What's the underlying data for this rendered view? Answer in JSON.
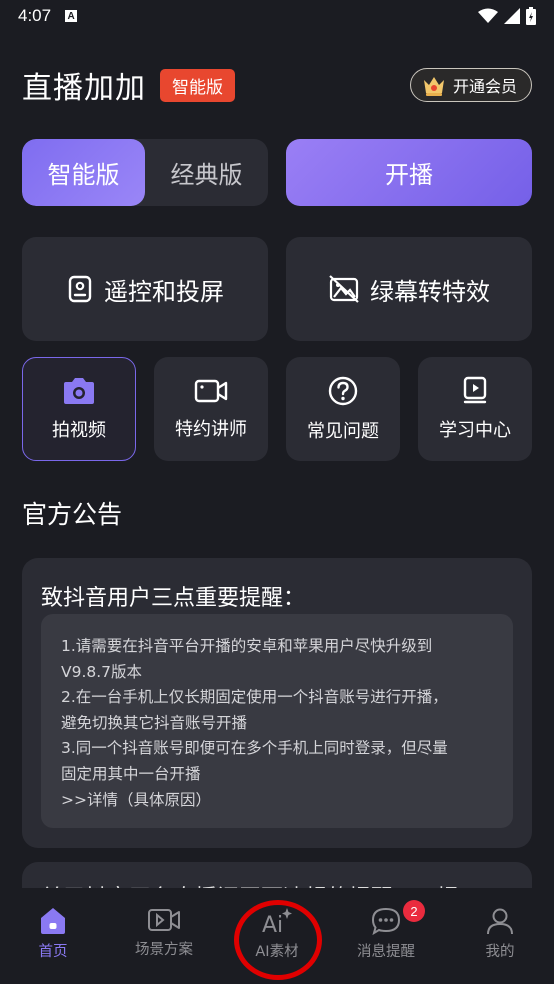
{
  "status_bar": {
    "time": "4:07",
    "notification_letter": "A"
  },
  "header": {
    "title": "直播加加",
    "badge": "智能版",
    "vip_button": "开通会员"
  },
  "mode_toggle": {
    "smart": "智能版",
    "classic": "经典版"
  },
  "broadcast_button": "开播",
  "big_cards": [
    {
      "label": "遥控和投屏",
      "icon": "remote-screen-icon"
    },
    {
      "label": "绿幕转特效",
      "icon": "green-screen-icon"
    }
  ],
  "small_cards": [
    {
      "label": "拍视频",
      "icon": "camera-icon"
    },
    {
      "label": "特约讲师",
      "icon": "video-camera-icon"
    },
    {
      "label": "常见问题",
      "icon": "question-icon"
    },
    {
      "label": "学习中心",
      "icon": "play-book-icon"
    }
  ],
  "announcement": {
    "section_title": "官方公告",
    "card_title": "致抖音用户三点重要提醒：",
    "lines": [
      "1.请需要在抖音平台开播的安卓和苹果用户尽快升级到",
      "V9.8.7版本",
      "2.在一台手机上仅长期固定使用一个抖音账号进行开播，",
      "避免切换其它抖音账号开播",
      "3.同一个抖音账号即便可在多个手机上同时登录，但尽量",
      "固定用其中一台开播",
      ">>详情（具体原因）"
    ]
  },
  "second_notice": {
    "title": "关于抖音平台直播间画面违规的提醒……提"
  },
  "tabbar": {
    "tabs": [
      {
        "label": "首页",
        "icon": "home-icon"
      },
      {
        "label": "场景方案",
        "icon": "scene-video-icon"
      },
      {
        "label": "AI素材",
        "icon": "ai-sparkle-icon"
      },
      {
        "label": "消息提醒",
        "icon": "message-icon"
      },
      {
        "label": "我的",
        "icon": "profile-icon"
      }
    ],
    "message_badge": "2"
  },
  "colors": {
    "accent": "#8a79f2",
    "badge_red": "#e8472f",
    "background": "#1b1c22",
    "card": "#2b2c34"
  }
}
